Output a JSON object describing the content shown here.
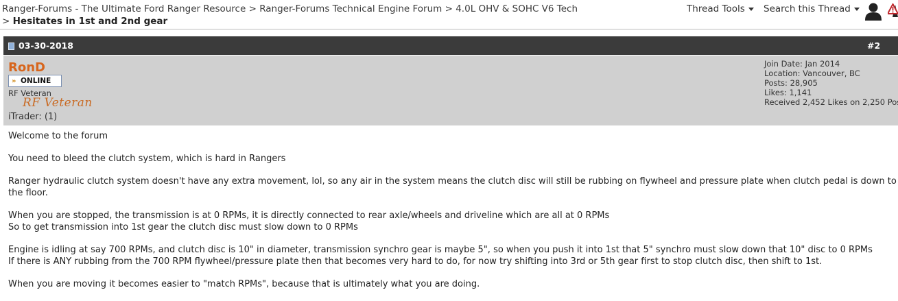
{
  "breadcrumb": {
    "items": [
      "Ranger-Forums - The Ultimate Ford Ranger Resource",
      "Ranger-Forums Technical Engine Forum",
      "4.0L OHV & SOHC V6 Tech"
    ],
    "separator": ">",
    "current": "Hesitates in 1st and 2nd gear"
  },
  "toolbar": {
    "thread_tools": "Thread Tools",
    "search_thread": "Search this Thread"
  },
  "post": {
    "date": "03-30-2018",
    "number": "#2",
    "user": {
      "name": "RonD",
      "status": "ONLINE",
      "title": "RF Veteran",
      "rank_image_text": "RF Veteran",
      "itrader": "iTrader: (1)"
    },
    "stats": {
      "join_date": "Join Date: Jan 2014",
      "location": "Location: Vancouver, BC",
      "posts": "Posts: 28,905",
      "likes": "Likes: 1,141",
      "received": "Received 2,452 Likes on 2,250 Pos"
    },
    "paragraphs": [
      "Welcome to the forum",
      "You need to bleed the clutch system, which is hard in Rangers",
      "Ranger hydraulic clutch system doesn't have any extra movement, lol, so any air in the system means the clutch disc will still be rubbing on flywheel and pressure plate when clutch pedal is down to the floor.",
      "When you are stopped, the transmission is at 0 RPMs, it is directly connected to rear axle/wheels and driveline which are all at 0 RPMs\nSo to get transmission into 1st gear the clutch disc must slow down to 0 RPMs",
      "Engine is idling at say 700 RPMs, and clutch disc is 10\" in diameter, transmission synchro gear is maybe 5\", so when you push it into 1st that 5\" synchro must slow down that 10\" disc to 0 RPMs\nIf there is ANY rubbing from the 700 RPM flywheel/pressure plate then that becomes very hard to do, for now try shifting into 3rd or 5th gear first to stop clutch disc, then shift to 1st.",
      "When you are moving it becomes easier to \"match RPMs\", because that is ultimately what you are doing."
    ]
  }
}
